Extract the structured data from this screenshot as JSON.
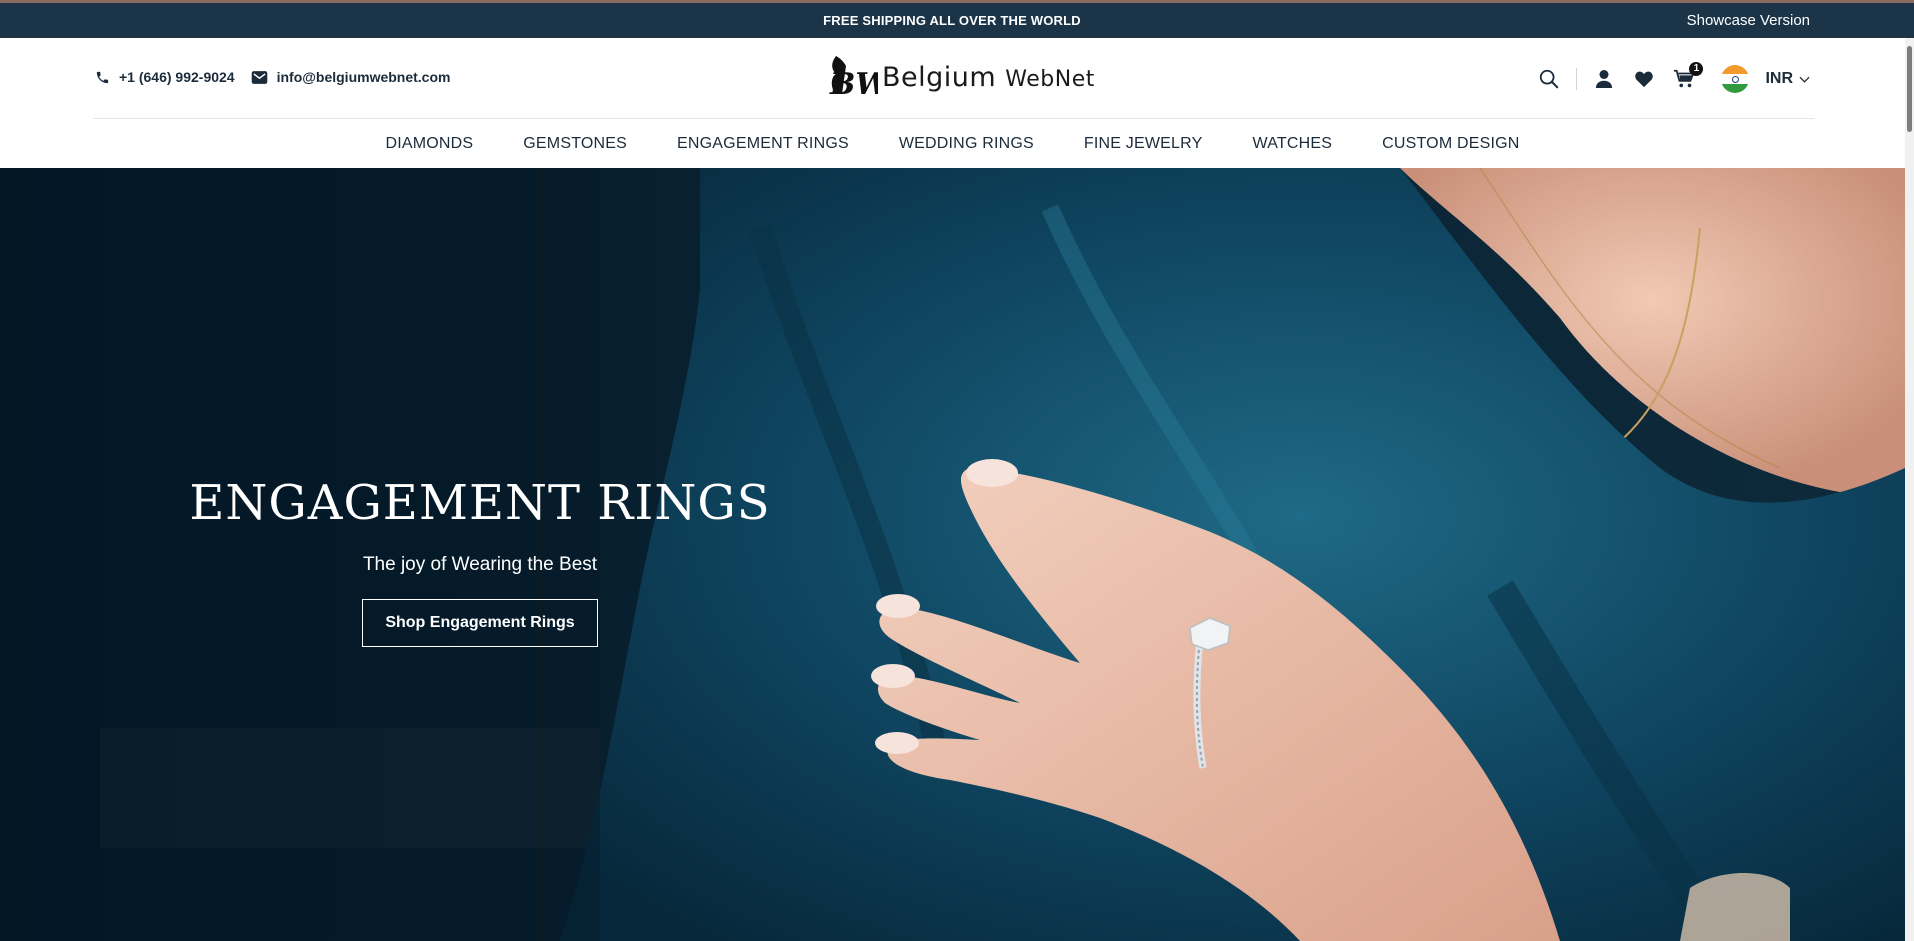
{
  "announcement": {
    "message": "FREE SHIPPING ALL OVER THE WORLD",
    "showcase": "Showcase Version"
  },
  "contact": {
    "phone": "+1 (646) 992-9024",
    "email": "info@belgiumwebnet.com"
  },
  "logo": {
    "brand_main": "Belgium",
    "brand_sub": "WebNet"
  },
  "tools": {
    "cart_count": "1",
    "currency": "INR"
  },
  "nav": {
    "items": [
      "DIAMONDS",
      "GEMSTONES",
      "ENGAGEMENT RINGS",
      "WEDDING RINGS",
      "FINE JEWELRY",
      "WATCHES",
      "CUSTOM DESIGN"
    ]
  },
  "hero": {
    "title": "ENGAGEMENT RINGS",
    "subtitle": "The joy of Wearing the Best",
    "button": "Shop Engagement Rings"
  },
  "colors": {
    "announcement_bg": "#1b3447",
    "text_dark": "#1c2b3a",
    "hero_bg": "#0b2233"
  }
}
